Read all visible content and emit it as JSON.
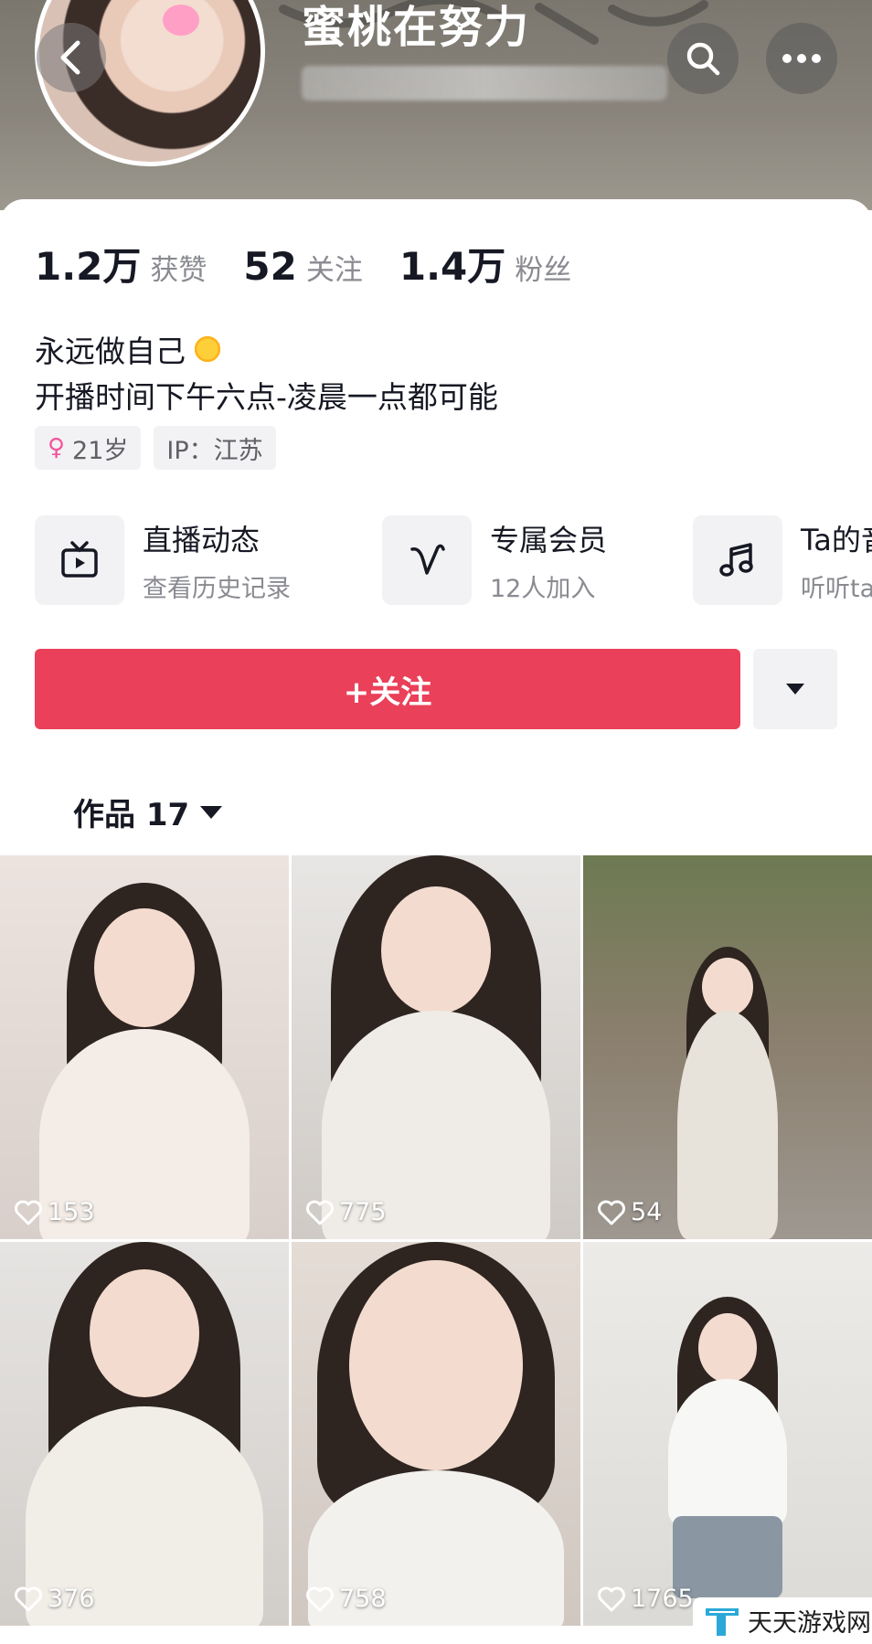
{
  "header": {
    "display_name": "蜜桃在努力",
    "back_icon": "chevron-left-icon",
    "search_icon": "search-icon",
    "more_icon": "more-icon"
  },
  "stats": [
    {
      "value": "1.2万",
      "label": "获赞"
    },
    {
      "value": "52",
      "label": "关注"
    },
    {
      "value": "1.4万",
      "label": "粉丝"
    }
  ],
  "bio": {
    "line1": "永远做自己",
    "line2": "开播时间下午六点-凌晨一点都可能"
  },
  "tags": {
    "age": "21岁",
    "ip": "IP：江苏"
  },
  "features": [
    {
      "icon": "live-tv-icon",
      "title": "直播动态",
      "subtitle": "查看历史记录"
    },
    {
      "icon": "member-v-icon",
      "title": "专属会员",
      "subtitle": "12人加入"
    },
    {
      "icon": "music-note-icon",
      "title": "Ta的音乐",
      "subtitle": "听听ta"
    }
  ],
  "actions": {
    "follow_label": "+关注"
  },
  "works_tab": {
    "label": "作品 17"
  },
  "videos": [
    {
      "likes": "153"
    },
    {
      "likes": "775"
    },
    {
      "likes": "54"
    },
    {
      "likes": "376"
    },
    {
      "likes": "758"
    },
    {
      "likes": "1765"
    }
  ],
  "watermark": {
    "text": "天天游戏网"
  },
  "colors": {
    "accent": "#ea4059",
    "header_bg": "#8a857c",
    "female": "#f2559d"
  }
}
